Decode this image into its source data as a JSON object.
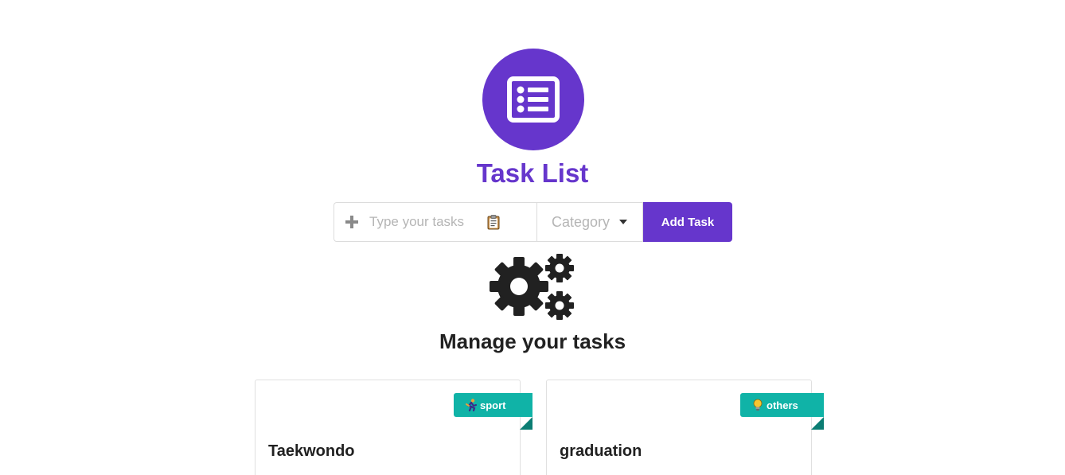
{
  "colors": {
    "accent": "#6636cc",
    "ribbon": "#10b3a7",
    "ribbon_fold": "#0b7d73",
    "text_dark": "#212121",
    "placeholder": "#b5b5b5"
  },
  "header": {
    "logo_icon": "list-alt-icon",
    "title": "Task List"
  },
  "form": {
    "add_icon": "plus-icon",
    "task_placeholder": "Type your tasks",
    "task_icon": "clipboard-icon",
    "category_value": "Category",
    "add_button_label": "Add Task"
  },
  "manage": {
    "icon": "gears-icon",
    "title": "Manage your tasks"
  },
  "tasks": [
    {
      "name": "Taekwondo",
      "category": "sport",
      "category_icon": "runner-icon"
    },
    {
      "name": "graduation",
      "category": "others",
      "category_icon": "lightbulb-icon"
    }
  ]
}
